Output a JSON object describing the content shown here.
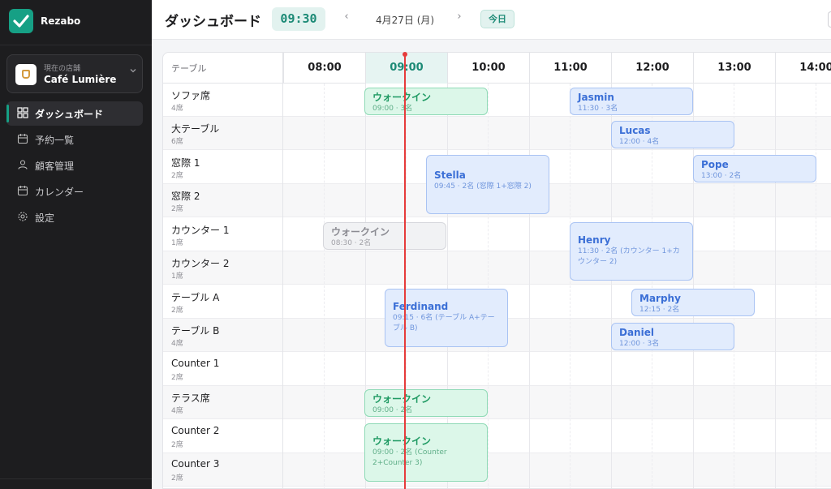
{
  "sidebar": {
    "brand": "Rezabo",
    "store_label": "現在の店舗",
    "store_name": "Café Lumière",
    "nav": [
      {
        "label": "ダッシュボード",
        "icon": "dashboard-icon",
        "active": true
      },
      {
        "label": "予約一覧",
        "icon": "calendar-icon"
      },
      {
        "label": "顧客管理",
        "icon": "users-icon"
      },
      {
        "label": "カレンダー",
        "icon": "calendar-icon"
      },
      {
        "label": "設定",
        "icon": "gear-icon"
      }
    ]
  },
  "header": {
    "title": "ダッシュボード",
    "clock": "09:30",
    "date": "4月27日 (月)",
    "today": "今日",
    "prev": "‹",
    "next": "›"
  },
  "grid": {
    "corner": "テーブル",
    "times": [
      "08:00",
      "09:00",
      "10:00",
      "11:00",
      "12:00",
      "13:00",
      "14:00"
    ],
    "current_time_index": 1
  },
  "tables": [
    {
      "name": "ソファ席",
      "cap": "4席"
    },
    {
      "name": "大テーブル",
      "cap": "6席"
    },
    {
      "name": "窓際 1",
      "cap": "2席"
    },
    {
      "name": "窓際 2",
      "cap": "2席"
    },
    {
      "name": "カウンター 1",
      "cap": "1席"
    },
    {
      "name": "カウンター 2",
      "cap": "1席"
    },
    {
      "name": "テーブル A",
      "cap": "2席"
    },
    {
      "name": "テーブル B",
      "cap": "4席"
    },
    {
      "name": "Counter 1",
      "cap": "2席"
    },
    {
      "name": "テラス席",
      "cap": "4席"
    },
    {
      "name": "Counter 2",
      "cap": "2席"
    },
    {
      "name": "Counter 3",
      "cap": "2席"
    }
  ],
  "reservations": [
    {
      "title": "ウォークイン",
      "sub": "09:00 · 3名",
      "kind": "green"
    },
    {
      "title": "Jasmin",
      "sub": "11:30 · 3名",
      "kind": "blue"
    },
    {
      "title": "Lucas",
      "sub": "12:00 · 4名",
      "kind": "blue"
    },
    {
      "title": "Stella",
      "sub": "09:45 · 2名 (窓際 1+窓際 2)",
      "kind": "blue"
    },
    {
      "title": "Pope",
      "sub": "13:00 · 2名",
      "kind": "blue"
    },
    {
      "title": "ウォークイン",
      "sub": "08:30 · 2名",
      "kind": "gray"
    },
    {
      "title": "Henry",
      "sub": "11:30 · 2名 (カウンター 1+カウンター 2)",
      "kind": "blue"
    },
    {
      "title": "Ferdinand",
      "sub": "09:15 · 6名 (テーブル A+テーブル B)",
      "kind": "blue"
    },
    {
      "title": "Marphy",
      "sub": "12:15 · 2名",
      "kind": "blue"
    },
    {
      "title": "Daniel",
      "sub": "12:00 · 3名",
      "kind": "blue"
    },
    {
      "title": "ウォークイン",
      "sub": "09:00 · 2名",
      "kind": "green"
    },
    {
      "title": "ウォークイン",
      "sub": "09:00 · 2名 (Counter 2+Counter 3)",
      "kind": "green"
    }
  ],
  "colors": {
    "accent": "#16a085",
    "now_line": "#e63b3b"
  }
}
